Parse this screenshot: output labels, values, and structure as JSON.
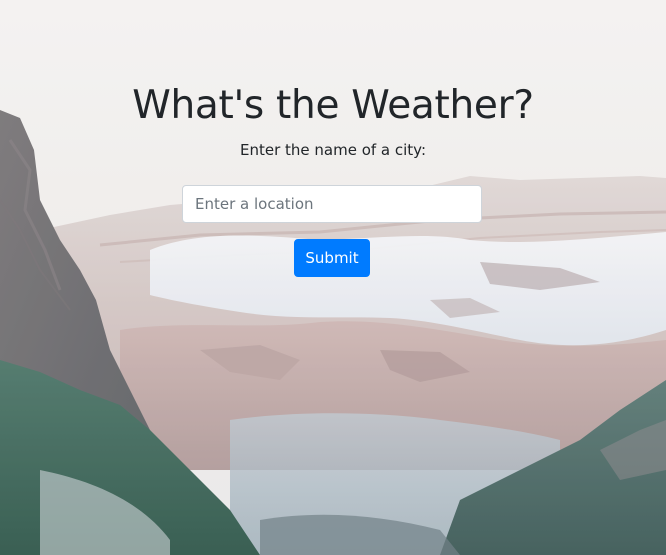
{
  "header": {
    "title": "What's the Weather?",
    "subtitle": "Enter the name of a city:"
  },
  "form": {
    "location_placeholder": "Enter a location",
    "location_value": "",
    "submit_label": "Submit"
  },
  "colors": {
    "title_text": "#212529",
    "button_bg": "#007bff",
    "button_text": "#ffffff",
    "input_border": "#ced4da",
    "placeholder_text": "#6c757d"
  },
  "background": {
    "description_icon": "mountain-landscape-photo"
  }
}
